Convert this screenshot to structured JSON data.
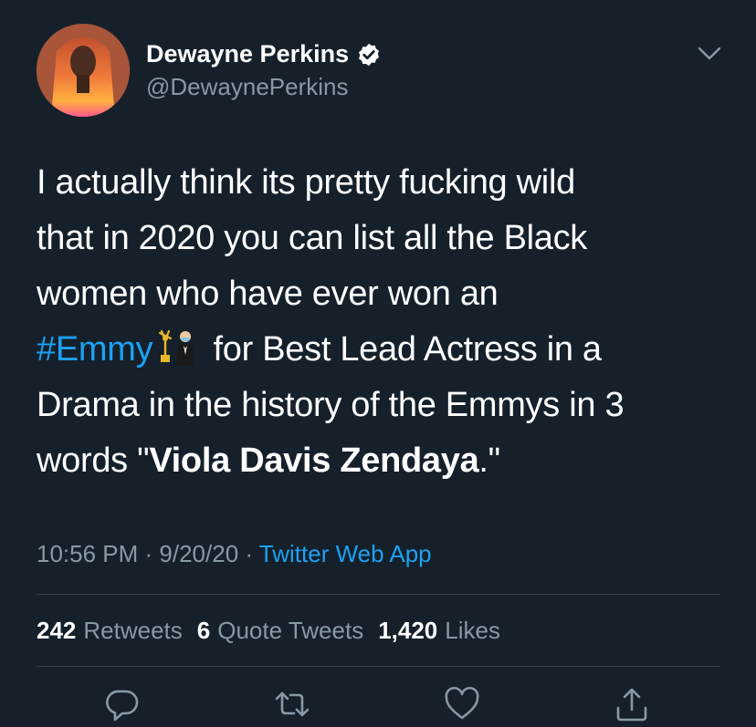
{
  "user": {
    "display_name": "Dewayne Perkins",
    "handle": "@DewaynePerkins",
    "verified": true
  },
  "tweet": {
    "lines": [
      "I actually think its pretty fucking wild",
      "that in 2020 you can list all the Black",
      "women who have ever won an"
    ],
    "hashtag": "#Emmy",
    "line4_rest": " for Best Lead Actress in a",
    "line5": "Drama in the history of the Emmys in 3",
    "line6_start": "words \"",
    "line6_bold": "Viola Davis Zendaya",
    "line6_end": ".\""
  },
  "meta": {
    "time": "10:56 PM",
    "separator1": " · ",
    "date": "9/20/20",
    "separator2": " · ",
    "source": "Twitter Web App"
  },
  "stats": {
    "retweets_count": "242",
    "retweets_label": "Retweets",
    "quote_count": "6",
    "quote_label": "Quote Tweets",
    "likes_count": "1,420",
    "likes_label": "Likes"
  },
  "icons": {
    "verified": "verified-badge-icon",
    "menu": "chevron-down-icon",
    "reply": "reply-icon",
    "retweet": "retweet-icon",
    "like": "heart-icon",
    "share": "share-icon"
  },
  "colors": {
    "background": "#15202b",
    "text": "#ffffff",
    "secondary": "#8899a6",
    "accent": "#1da1f2",
    "divider": "#38444d"
  }
}
